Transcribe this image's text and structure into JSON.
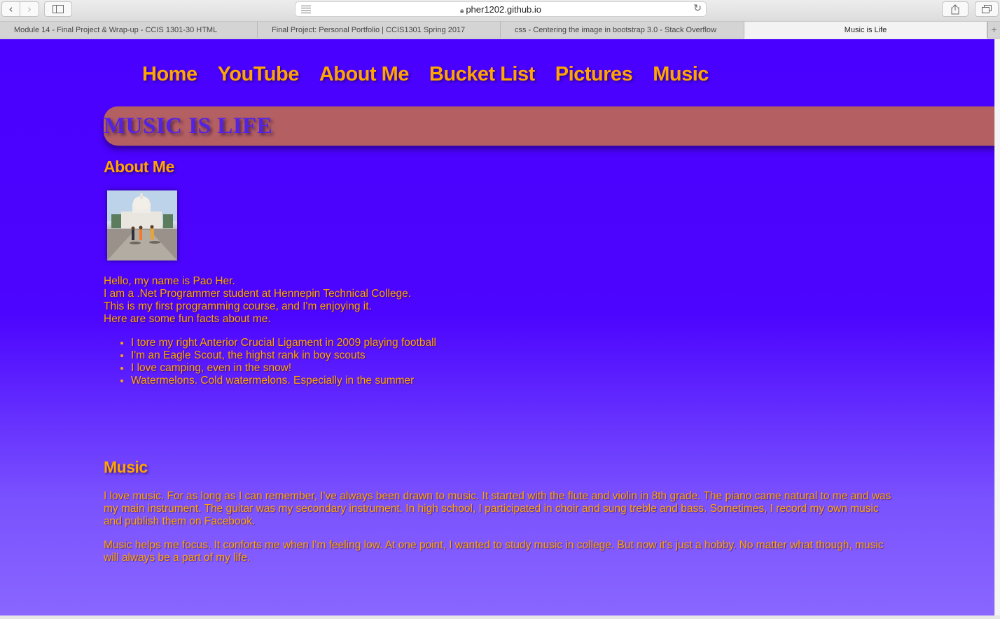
{
  "browser": {
    "url": "pher1202.github.io",
    "tabs": [
      {
        "label": "Module 14 - Final Project & Wrap-up - CCIS 1301-30 HTML",
        "active": false
      },
      {
        "label": "Final Project: Personal Portfolio | CCIS1301 Spring 2017",
        "active": false
      },
      {
        "label": "css - Centering the image in bootstrap 3.0 - Stack Overflow",
        "active": false
      },
      {
        "label": "Music is Life",
        "active": true
      }
    ],
    "icons": {
      "back": "chevron-left-icon",
      "forward": "chevron-right-icon",
      "sidebar": "sidebar-icon",
      "reader": "reader-icon",
      "lock": "lock-icon",
      "reload": "reload-icon",
      "share": "share-icon",
      "tabs": "tabs-overview-icon",
      "new_tab": "plus-icon"
    }
  },
  "site": {
    "nav": [
      "Home",
      "YouTube",
      "About Me",
      "Bucket List",
      "Pictures",
      "Music"
    ],
    "banner_title": "MUSIC IS LIFE",
    "about": {
      "heading": "About Me",
      "intro_lines": [
        "Hello, my name is Pao Her.",
        "I am a .Net Programmer student at Hennepin Technical College.",
        "This is my first programming course, and I'm enjoying it.",
        "Here are some fun facts about me."
      ],
      "facts": [
        "I tore my right Anterior Crucial Ligament in 2009 playing football",
        "I'm an Eagle Scout, the highst rank in boy scouts",
        "I love camping, even in the snow!",
        "Watermelons. Cold watermelons. Especially in the summer"
      ]
    },
    "music": {
      "heading": "Music",
      "paragraphs": [
        "I love music. For as long as I can remember, I've always been drawn to music. It started with the flute and violin in 8th grade. The piano came natural to me and was my main instrument. The guitar was my secondary instrument. In high school, I participated in choir and sung treble and bass. Sometimes, I record my own music and publish them on Facebook.",
        "Music helps me focus. It conforts me when I'm feeling low. At one point, I wanted to study music in college. But now it's just a hobby. No matter what though, music will always be a part of my life."
      ]
    },
    "colors": {
      "background": "#4a00fe",
      "accent_text": "#ffa400",
      "banner": "#b46062",
      "banner_text": "#5222e6"
    }
  }
}
